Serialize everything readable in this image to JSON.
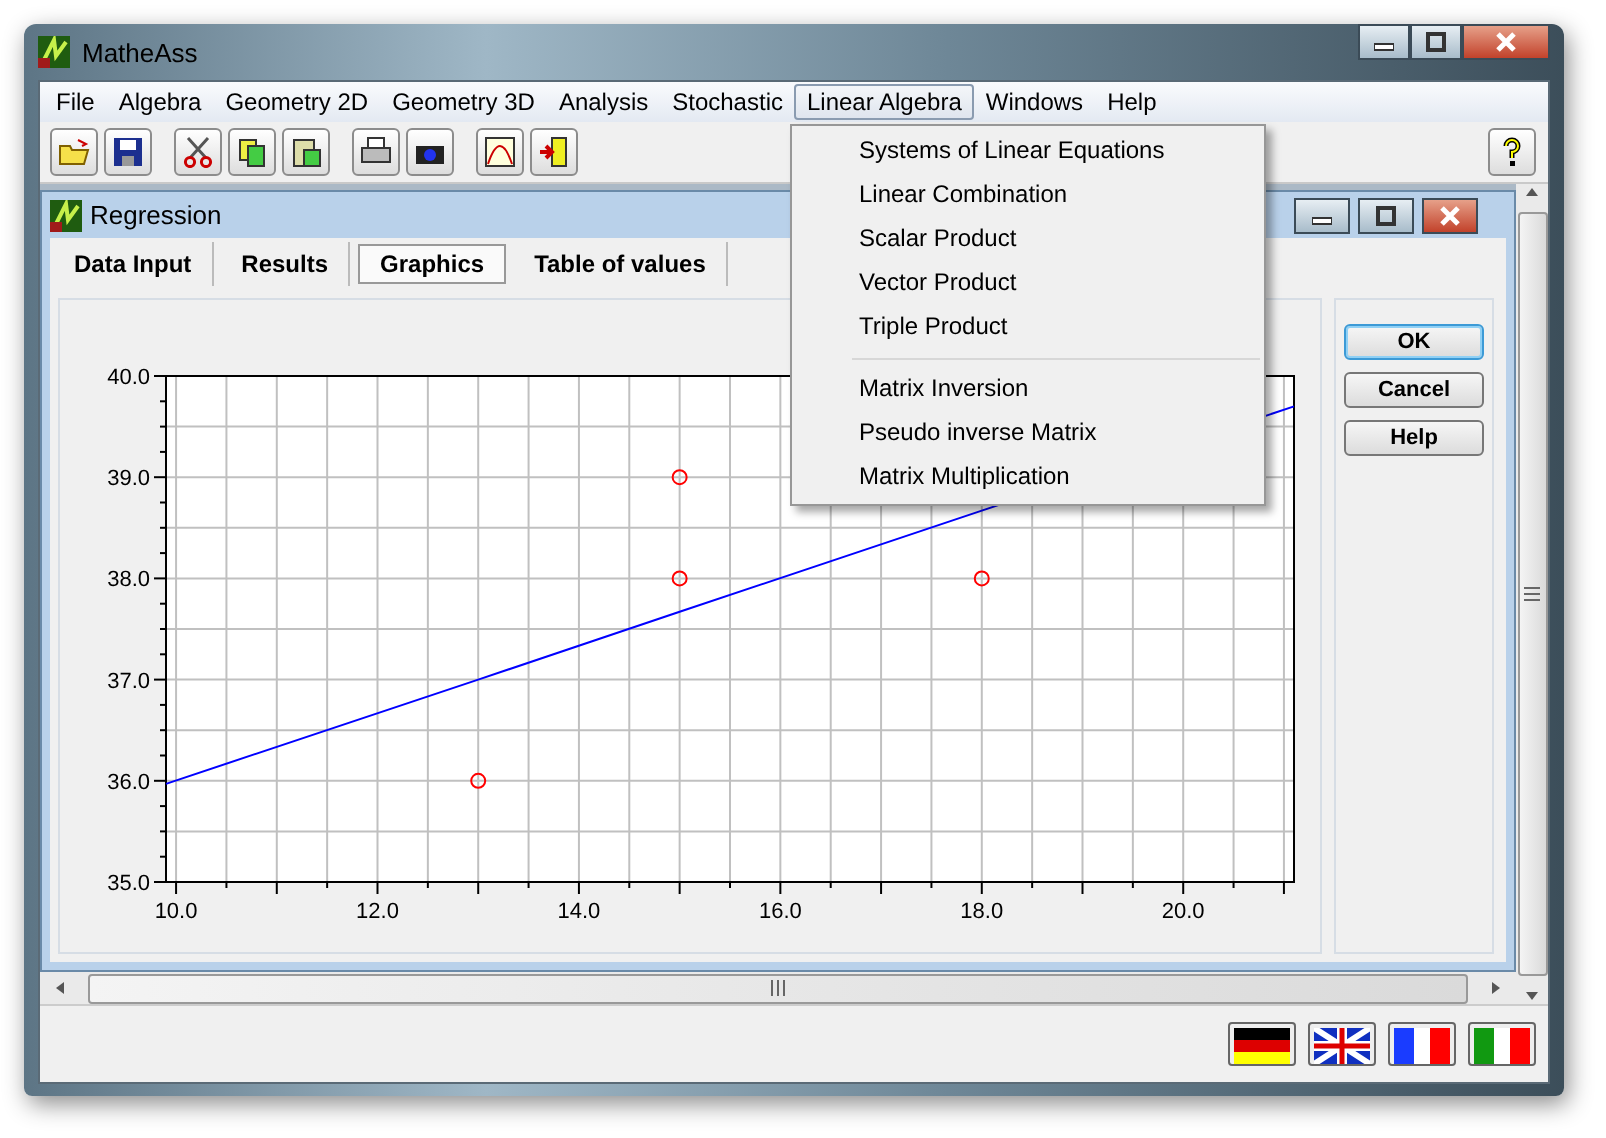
{
  "window": {
    "title": "MatheAss"
  },
  "menu": [
    {
      "label": "File",
      "selected": false
    },
    {
      "label": "Algebra",
      "selected": false
    },
    {
      "label": "Geometry 2D",
      "selected": false
    },
    {
      "label": "Geometry 3D",
      "selected": false
    },
    {
      "label": "Analysis",
      "selected": false
    },
    {
      "label": "Stochastic",
      "selected": false
    },
    {
      "label": "Linear Algebra",
      "selected": true
    },
    {
      "label": "Windows",
      "selected": false
    },
    {
      "label": "Help",
      "selected": false
    }
  ],
  "dropdown": {
    "sections": [
      [
        "Systems of Linear Equations",
        "Linear Combination",
        "Scalar Product",
        "Vector Product",
        "Triple Product"
      ],
      [
        "Matrix Inversion",
        "Pseudo inverse Matrix",
        "Matrix Multiplication"
      ]
    ]
  },
  "child_window": {
    "title": "Regression",
    "tabs": [
      {
        "label": "Data Input",
        "selected": false
      },
      {
        "label": "Results",
        "selected": false
      },
      {
        "label": "Graphics",
        "selected": true
      },
      {
        "label": "Table of values",
        "selected": false
      }
    ],
    "buttons": [
      {
        "label": "OK",
        "default": true
      },
      {
        "label": "Cancel",
        "default": false
      },
      {
        "label": "Help",
        "default": false
      }
    ],
    "chart_data": {
      "type": "scatter",
      "grid": true,
      "xlim": [
        9.9,
        21.1
      ],
      "ylim": [
        35,
        40
      ],
      "xticks": [
        {
          "value": 10,
          "label": "10.0"
        },
        {
          "value": 12,
          "label": "12.0"
        },
        {
          "value": 14,
          "label": "14.0"
        },
        {
          "value": 16,
          "label": "16.0"
        },
        {
          "value": 18,
          "label": "18.0"
        },
        {
          "value": 20,
          "label": "20.0"
        }
      ],
      "yticks": [
        {
          "value": 35,
          "label": "35.0"
        },
        {
          "value": 36,
          "label": "36.0"
        },
        {
          "value": 37,
          "label": "37.0"
        },
        {
          "value": 38,
          "label": "38.0"
        },
        {
          "value": 39,
          "label": "39.0"
        },
        {
          "value": 40,
          "label": "40.0"
        }
      ],
      "x": [
        9.9,
        13,
        15,
        15,
        18,
        21.1
      ],
      "series": [
        {
          "type": "scatter",
          "color": "#ff0000",
          "values": [
            null,
            36,
            39,
            38,
            38,
            null
          ]
        },
        {
          "type": "line",
          "color": "#0000ff",
          "values": [
            35.97,
            37,
            37.67,
            37.67,
            38.67,
            39.7
          ]
        }
      ]
    }
  }
}
